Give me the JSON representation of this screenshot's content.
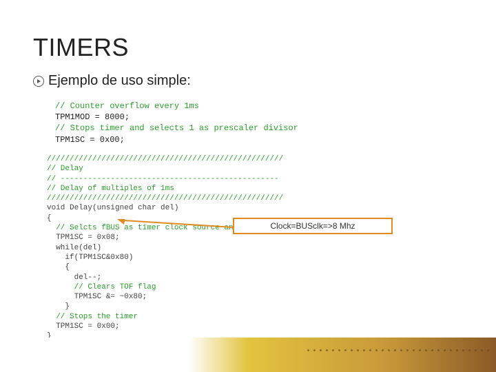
{
  "title": "TIMERS",
  "subtitle": "Ejemplo de uso simple:",
  "code1": [
    {
      "t": "// Counter overflow every 1ms",
      "c": "comment"
    },
    {
      "t": "TPM1MOD = 8000;",
      "c": ""
    },
    {
      "t": "// Stops timer and selects 1 as prescaler divisor",
      "c": "comment"
    },
    {
      "t": "TPM1SC = 0x00;",
      "c": ""
    }
  ],
  "code2": [
    {
      "t": "////////////////////////////////////////////////////",
      "c": "comment"
    },
    {
      "t": "// Delay",
      "c": "comment"
    },
    {
      "t": "// ------------------------------------------------",
      "c": "comment"
    },
    {
      "t": "// Delay of multiples of 1ms",
      "c": "comment"
    },
    {
      "t": "////////////////////////////////////////////////////",
      "c": "comment"
    },
    {
      "t": "void Delay(unsigned char del)",
      "c": ""
    },
    {
      "t": "{",
      "c": ""
    },
    {
      "t": "  // Selcts fBUS as timer clock source and starts the timer",
      "c": "comment"
    },
    {
      "t": "  TPM1SC = 0x08;",
      "c": ""
    },
    {
      "t": "  while(del)",
      "c": ""
    },
    {
      "t": "    if(TPM1SC&0x80)",
      "c": ""
    },
    {
      "t": "    {",
      "c": ""
    },
    {
      "t": "      del--;",
      "c": ""
    },
    {
      "t": "      // Clears TOF flag",
      "c": "comment"
    },
    {
      "t": "      TPM1SC &= ~0x80;",
      "c": ""
    },
    {
      "t": "    }",
      "c": ""
    },
    {
      "t": "  // Stops the timer",
      "c": "comment"
    },
    {
      "t": "  TPM1SC = 0x00;",
      "c": ""
    },
    {
      "t": "}",
      "c": ""
    }
  ],
  "callout": "Clock=BUSclk=>8 Mhz"
}
